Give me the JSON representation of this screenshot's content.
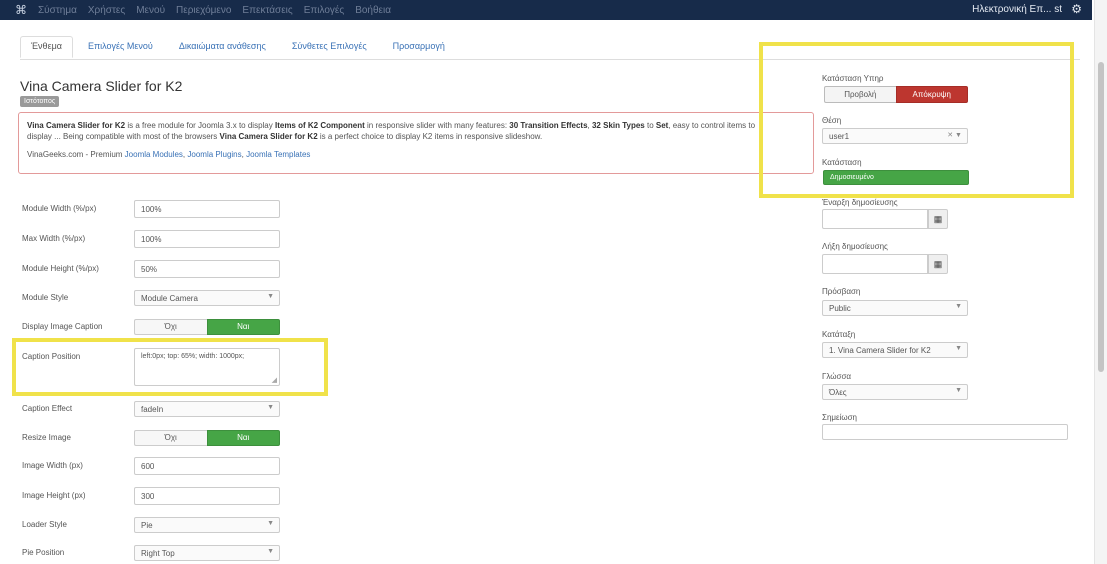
{
  "navbar": {
    "menu": [
      "Σύστημα",
      "Χρήστες",
      "Μενού",
      "Περιεχόμενο",
      "Επεκτάσεις",
      "Επιλογές",
      "Βοήθεια"
    ],
    "user": "Ηλεκτρονική Επ... st",
    "logo_icon": "joomla-icon",
    "gear_icon": "gear-icon"
  },
  "tabs": [
    "Ένθεμα",
    "Επιλογές Μενού",
    "Δικαιώματα ανάθεσης",
    "Σύνθετες Επιλογές",
    "Προσαρμογή"
  ],
  "module": {
    "title": "Vina Camera Slider for K2",
    "badge": "Ιστότοπος",
    "desc_line1_a": "Vina Camera Slider for K2",
    "desc_line1_b": " is a free module for Joomla 3.x to display ",
    "desc_line1_c": "Items of K2 Component",
    "desc_line1_d": " in responsive slider with many features: ",
    "desc_line1_e": "30 Transition Effects",
    "desc_line1_f": ", ",
    "desc_line1_g": "32 Skin Types",
    "desc_line1_h": " to ",
    "desc_line1_i": "Set",
    "desc_line1_j": ", easy to control items to",
    "desc_line2_a": "display ... Being compatible with most of the browsers ",
    "desc_line2_b": "Vina Camera Slider for K2",
    "desc_line2_c": " is a perfect choice to display K2 items in responsive slideshow.",
    "links_prefix": "VinaGeeks.com - Premium ",
    "link1": "Joomla Modules",
    "link2": "Joomla Plugins",
    "link3": "Joomla Templates"
  },
  "form": {
    "module_width": {
      "label": "Module Width (%/px)",
      "value": "100%"
    },
    "max_width": {
      "label": "Max Width (%/px)",
      "value": "100%"
    },
    "module_height": {
      "label": "Module Height (%/px)",
      "value": "50%"
    },
    "module_style": {
      "label": "Module Style",
      "value": "Module Camera"
    },
    "display_caption": {
      "label": "Display Image Caption",
      "off": "Όχι",
      "on": "Ναι"
    },
    "caption_position": {
      "label": "Caption Position",
      "value": "left:0px; top: 65%; width: 1000px;"
    },
    "caption_effect": {
      "label": "Caption Effect",
      "value": "fadeIn"
    },
    "resize_image": {
      "label": "Resize Image",
      "off": "Όχι",
      "on": "Ναι"
    },
    "image_width": {
      "label": "Image Width (px)",
      "value": "600"
    },
    "image_height": {
      "label": "Image Height (px)",
      "value": "300"
    },
    "loader_style": {
      "label": "Loader Style",
      "value": "Pie"
    },
    "pie_position": {
      "label": "Pie Position",
      "value": "Right Top"
    }
  },
  "right": {
    "status_label": "Κατάσταση Υπηρ",
    "show": "Προβολή",
    "hide": "Απόκρυψη",
    "position_label": "Θέση",
    "position_value": "user1",
    "state_label": "Κατάσταση",
    "state_value": "Δημοσιευμένο",
    "start_label": "Έναρξη δημοσίευσης",
    "finish_label": "Λήξη δημοσίευσης",
    "access_label": "Πρόσβαση",
    "access_value": "Public",
    "ordering_label": "Κατάταξη",
    "ordering_value": "1. Vina Camera Slider for K2",
    "language_label": "Γλώσσα",
    "language_value": "Όλες",
    "note_label": "Σημείωση",
    "calendar_icon": "calendar-icon"
  }
}
